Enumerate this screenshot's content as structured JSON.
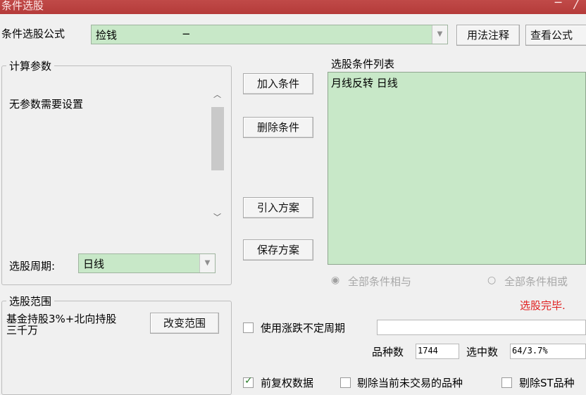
{
  "window": {
    "title": "条件选股",
    "controls": "─ ╱"
  },
  "formula": {
    "label": "条件选股公式",
    "value": "捡钱",
    "value_suffix": "−",
    "usage_button": "用法注释",
    "view_button": "查看公式"
  },
  "params": {
    "legend": "计算参数",
    "message": "无参数需要设置",
    "period_label": "选股周期:",
    "period_value": "日线"
  },
  "actions": {
    "add": "加入条件",
    "delete": "删除条件",
    "import": "引入方案",
    "save": "保存方案"
  },
  "conditions": {
    "label": "选股条件列表",
    "items": [
      "月线反转  日线"
    ],
    "radio_and": "全部条件相与",
    "radio_or": "全部条件相或",
    "status": "选股完毕."
  },
  "scope": {
    "legend": "选股范围",
    "line1": "基金持股3%+北向持股",
    "line2": "三千万",
    "change_button": "改变范围"
  },
  "options": {
    "variable_period_label": "使用涨跌不定周期",
    "variable_period_checked": false,
    "count_label": "品种数",
    "count_value": "1744",
    "selected_label": "选中数",
    "selected_value": "64/3.7%",
    "pre_adjust_label": "前复权数据",
    "pre_adjust_checked": true,
    "exclude_untraded_label": "剔除当前未交易的品种",
    "exclude_untraded_checked": false,
    "exclude_st_label": "剔除ST品种",
    "exclude_st_checked": false
  },
  "colors": {
    "title_bar": "#b53b3a",
    "green_field": "#c8e8c8",
    "status_red": "#e02020"
  }
}
